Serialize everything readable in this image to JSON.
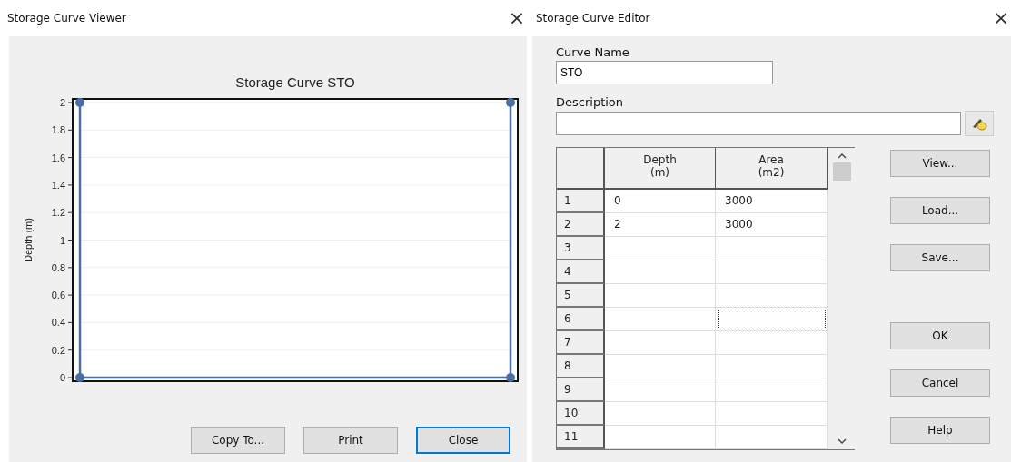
{
  "viewer": {
    "title": "Storage Curve Viewer",
    "close": "×",
    "chart": {
      "title": "Storage Curve STO",
      "y_axis_label": "Depth (m)",
      "y_tick_labels": [
        "2",
        "1.8",
        "1.6",
        "1.4",
        "1.2",
        "1",
        "0.8",
        "0.6",
        "0.4",
        "0.2",
        "0"
      ]
    },
    "buttons": [
      {
        "label": "Copy To...",
        "default": false
      },
      {
        "label": "Print",
        "default": false
      },
      {
        "label": "Close",
        "default": true
      }
    ]
  },
  "editor": {
    "title": "Storage Curve Editor",
    "close": "×",
    "curve_name": {
      "label": "Curve Name",
      "value": "STO"
    },
    "description": {
      "label": "Description"
    },
    "table": {
      "columns": [
        "Depth\n(m)",
        "Area\n(m2)"
      ],
      "rows": [
        {
          "number": "1",
          "depth": "0",
          "area": "3000",
          "area_focused": false
        },
        {
          "number": "2",
          "depth": "2",
          "area": "3000",
          "area_focused": false
        },
        {
          "number": "3",
          "area_focused": false
        },
        {
          "number": "4",
          "area_focused": false
        },
        {
          "number": "5",
          "area_focused": false
        },
        {
          "number": "6",
          "area_focused": true
        },
        {
          "number": "7",
          "area_focused": false
        },
        {
          "number": "8",
          "area_focused": false
        },
        {
          "number": "9",
          "area_focused": false
        },
        {
          "number": "10",
          "area_focused": false
        },
        {
          "number": "11",
          "area_focused": false
        }
      ]
    },
    "file_buttons": [
      "View...",
      "Load...",
      "Save..."
    ],
    "dialog_buttons": [
      "OK",
      "Cancel",
      "Help"
    ]
  }
}
